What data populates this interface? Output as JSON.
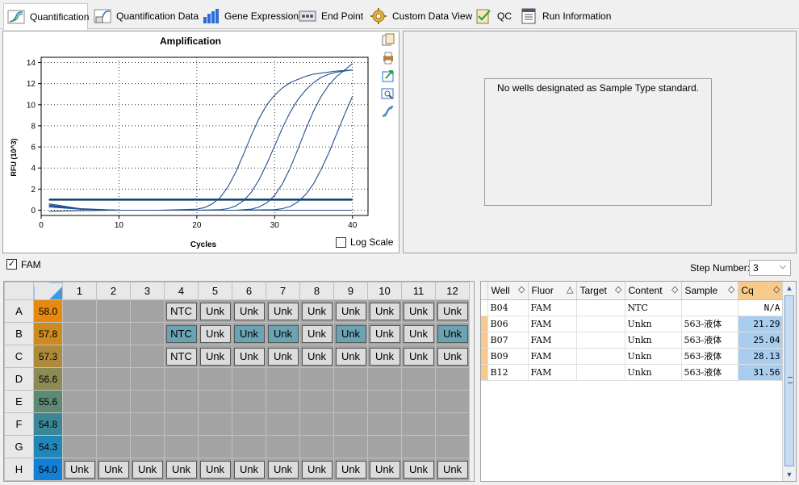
{
  "tabs": [
    {
      "label": "Quantification",
      "icon": "amplification-curve-icon",
      "active": true
    },
    {
      "label": "Quantification Data",
      "icon": "quantification-data-icon",
      "active": false
    },
    {
      "label": "Gene Expression",
      "icon": "bar-chart-icon",
      "active": false
    },
    {
      "label": "End Point",
      "icon": "end-point-icon",
      "active": false
    },
    {
      "label": "Custom Data View",
      "icon": "gear-icon",
      "active": false
    },
    {
      "label": "QC",
      "icon": "qc-check-icon",
      "active": false
    },
    {
      "label": "Run Information",
      "icon": "run-info-icon",
      "active": false
    }
  ],
  "chart": {
    "log_scale_label": "Log Scale",
    "toolbar": [
      "copy-icon",
      "print-icon",
      "export-icon",
      "zoom-icon",
      "trace-style-icon"
    ]
  },
  "chart_data": {
    "type": "line",
    "title": "Amplification",
    "xlabel": "Cycles",
    "ylabel": "RFU (10^3)",
    "xlim": [
      0,
      42
    ],
    "ylim": [
      -0.5,
      14.5
    ],
    "xticks": [
      0,
      10,
      20,
      30,
      40
    ],
    "yticks": [
      0,
      2,
      4,
      6,
      8,
      10,
      12,
      14
    ],
    "grid": true,
    "threshold": 1.0,
    "series": [
      {
        "x": [
          1,
          5,
          10,
          15,
          18,
          20,
          21,
          22,
          23,
          24,
          25,
          26,
          27,
          28,
          29,
          30,
          31,
          32,
          33,
          34,
          35,
          36,
          38,
          40
        ],
        "y": [
          0.3,
          0.1,
          0.0,
          0.0,
          0.05,
          0.1,
          0.25,
          0.6,
          1.2,
          2.2,
          3.6,
          5.3,
          7.1,
          8.7,
          10.0,
          10.9,
          11.6,
          12.1,
          12.4,
          12.7,
          12.9,
          13.0,
          13.2,
          13.3
        ]
      },
      {
        "x": [
          1,
          5,
          10,
          15,
          20,
          23,
          24,
          25,
          26,
          27,
          28,
          29,
          30,
          31,
          32,
          33,
          34,
          35,
          36,
          37,
          38,
          40
        ],
        "y": [
          0.5,
          0.1,
          0.0,
          0.0,
          0.0,
          0.05,
          0.15,
          0.4,
          0.9,
          1.7,
          2.9,
          4.4,
          6.1,
          7.8,
          9.3,
          10.5,
          11.4,
          12.1,
          12.6,
          12.9,
          13.1,
          13.3
        ]
      },
      {
        "x": [
          1,
          5,
          10,
          15,
          20,
          25,
          27,
          28,
          29,
          30,
          31,
          32,
          33,
          34,
          35,
          36,
          37,
          38,
          39,
          40
        ],
        "y": [
          0.6,
          0.15,
          0.0,
          0.0,
          0.0,
          0.0,
          0.1,
          0.3,
          0.7,
          1.4,
          2.5,
          4.0,
          5.8,
          7.7,
          9.4,
          10.8,
          11.9,
          12.7,
          13.3,
          13.9
        ]
      },
      {
        "x": [
          1,
          5,
          10,
          15,
          20,
          25,
          30,
          31,
          32,
          33,
          34,
          35,
          36,
          37,
          38,
          39,
          40
        ],
        "y": [
          0.4,
          0.1,
          0.0,
          0.0,
          0.0,
          0.0,
          0.05,
          0.15,
          0.35,
          0.8,
          1.5,
          2.5,
          3.9,
          5.5,
          7.3,
          9.1,
          10.8
        ]
      },
      {
        "x": [
          1,
          5,
          10,
          20,
          30,
          40
        ],
        "y": [
          -0.1,
          -0.05,
          0.0,
          0.0,
          0.0,
          0.0
        ]
      }
    ]
  },
  "standard_message": "No wells designated as Sample Type standard.",
  "fam": {
    "label": "FAM",
    "checked": true
  },
  "step": {
    "label": "Step Number:",
    "value": "3"
  },
  "plate": {
    "columns": [
      "1",
      "2",
      "3",
      "4",
      "5",
      "6",
      "7",
      "8",
      "9",
      "10",
      "11",
      "12"
    ],
    "rows": [
      {
        "label": "A",
        "temp": "58.0",
        "color": "#e68a0f",
        "wells": [
          "",
          "",
          "",
          "NTC",
          "Unk",
          "Unk",
          "Unk",
          "Unk",
          "Unk",
          "Unk",
          "Unk",
          "Unk"
        ],
        "selected": []
      },
      {
        "label": "B",
        "temp": "57.8",
        "color": "#cc8a20",
        "wells": [
          "",
          "",
          "",
          "NTC",
          "Unk",
          "Unk",
          "Unk",
          "Unk",
          "Unk",
          "Unk",
          "Unk",
          "Unk"
        ],
        "selected": [
          3,
          5,
          6,
          8,
          11
        ]
      },
      {
        "label": "C",
        "temp": "57.3",
        "color": "#ae8b3a",
        "wells": [
          "",
          "",
          "",
          "NTC",
          "Unk",
          "Unk",
          "Unk",
          "Unk",
          "Unk",
          "Unk",
          "Unk",
          "Unk"
        ],
        "selected": []
      },
      {
        "label": "D",
        "temp": "56.6",
        "color": "#8c8b55",
        "wells": [
          "",
          "",
          "",
          "",
          "",
          "",
          "",
          "",
          "",
          "",
          "",
          ""
        ],
        "selected": []
      },
      {
        "label": "E",
        "temp": "55.6",
        "color": "#5d8a73",
        "wells": [
          "",
          "",
          "",
          "",
          "",
          "",
          "",
          "",
          "",
          "",
          "",
          ""
        ],
        "selected": []
      },
      {
        "label": "F",
        "temp": "54.8",
        "color": "#3a8896",
        "wells": [
          "",
          "",
          "",
          "",
          "",
          "",
          "",
          "",
          "",
          "",
          "",
          ""
        ],
        "selected": []
      },
      {
        "label": "G",
        "temp": "54.3",
        "color": "#2386b8",
        "wells": [
          "",
          "",
          "",
          "",
          "",
          "",
          "",
          "",
          "",
          "",
          "",
          ""
        ],
        "selected": []
      },
      {
        "label": "H",
        "temp": "54.0",
        "color": "#1180d6",
        "wells": [
          "Unk",
          "Unk",
          "Unk",
          "Unk",
          "Unk",
          "Unk",
          "Unk",
          "Unk",
          "Unk",
          "Unk",
          "Unk",
          "Unk"
        ],
        "selected": []
      }
    ]
  },
  "results": {
    "headers": [
      "Well",
      "Fluor",
      "Target",
      "Content",
      "Sample",
      "Cq"
    ],
    "sort_icons": [
      "◇",
      "△",
      "◇",
      "◇",
      "◇",
      "◇"
    ],
    "rows": [
      {
        "well": "B04",
        "fluor": "FAM",
        "target": "",
        "content": "NTC",
        "sample": "",
        "cq": "N/A"
      },
      {
        "well": "B06",
        "fluor": "FAM",
        "target": "",
        "content": "Unkn",
        "sample": "563-液体",
        "cq": "21.29"
      },
      {
        "well": "B07",
        "fluor": "FAM",
        "target": "",
        "content": "Unkn",
        "sample": "563-液体",
        "cq": "25.04"
      },
      {
        "well": "B09",
        "fluor": "FAM",
        "target": "",
        "content": "Unkn",
        "sample": "563-液体",
        "cq": "28.13"
      },
      {
        "well": "B12",
        "fluor": "FAM",
        "target": "",
        "content": "Unkn",
        "sample": "563-液体",
        "cq": "31.56"
      }
    ]
  }
}
